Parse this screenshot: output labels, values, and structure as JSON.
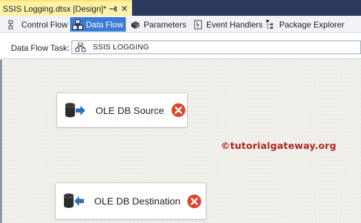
{
  "document_tab": {
    "title": "SSIS Logging.dtsx [Design]*",
    "pin_icon": "pin-icon",
    "close_icon": "close-icon",
    "close_glyph": "✕"
  },
  "designer_tabs": [
    {
      "label": "Control Flow",
      "icon": "control-flow-icon",
      "active": false
    },
    {
      "label": "Data Flow",
      "icon": "data-flow-icon",
      "active": true
    },
    {
      "label": "Parameters",
      "icon": "parameters-icon",
      "active": false
    },
    {
      "label": "Event Handlers",
      "icon": "event-handlers-icon",
      "active": false
    },
    {
      "label": "Package Explorer",
      "icon": "package-explorer-icon",
      "active": false
    }
  ],
  "data_flow_task": {
    "label": "Data Flow Task:",
    "value": "SSIS LOGGING",
    "icon": "data-flow-task-icon"
  },
  "components": [
    {
      "label": "OLE DB Source",
      "icon": "ole-db-source-icon",
      "status_icon": "error-icon"
    },
    {
      "label": "OLE DB Destination",
      "icon": "ole-db-destination-icon",
      "status_icon": "error-icon"
    }
  ],
  "watermark": "©tutorialgateway.org",
  "colors": {
    "tab_active_bg": "#fff2a8",
    "tabstrip_bg": "#2b3a5c",
    "designer_tab_active_bg": "#3b7bd4",
    "error_red": "#d9462b",
    "watermark_red": "#b22222"
  }
}
